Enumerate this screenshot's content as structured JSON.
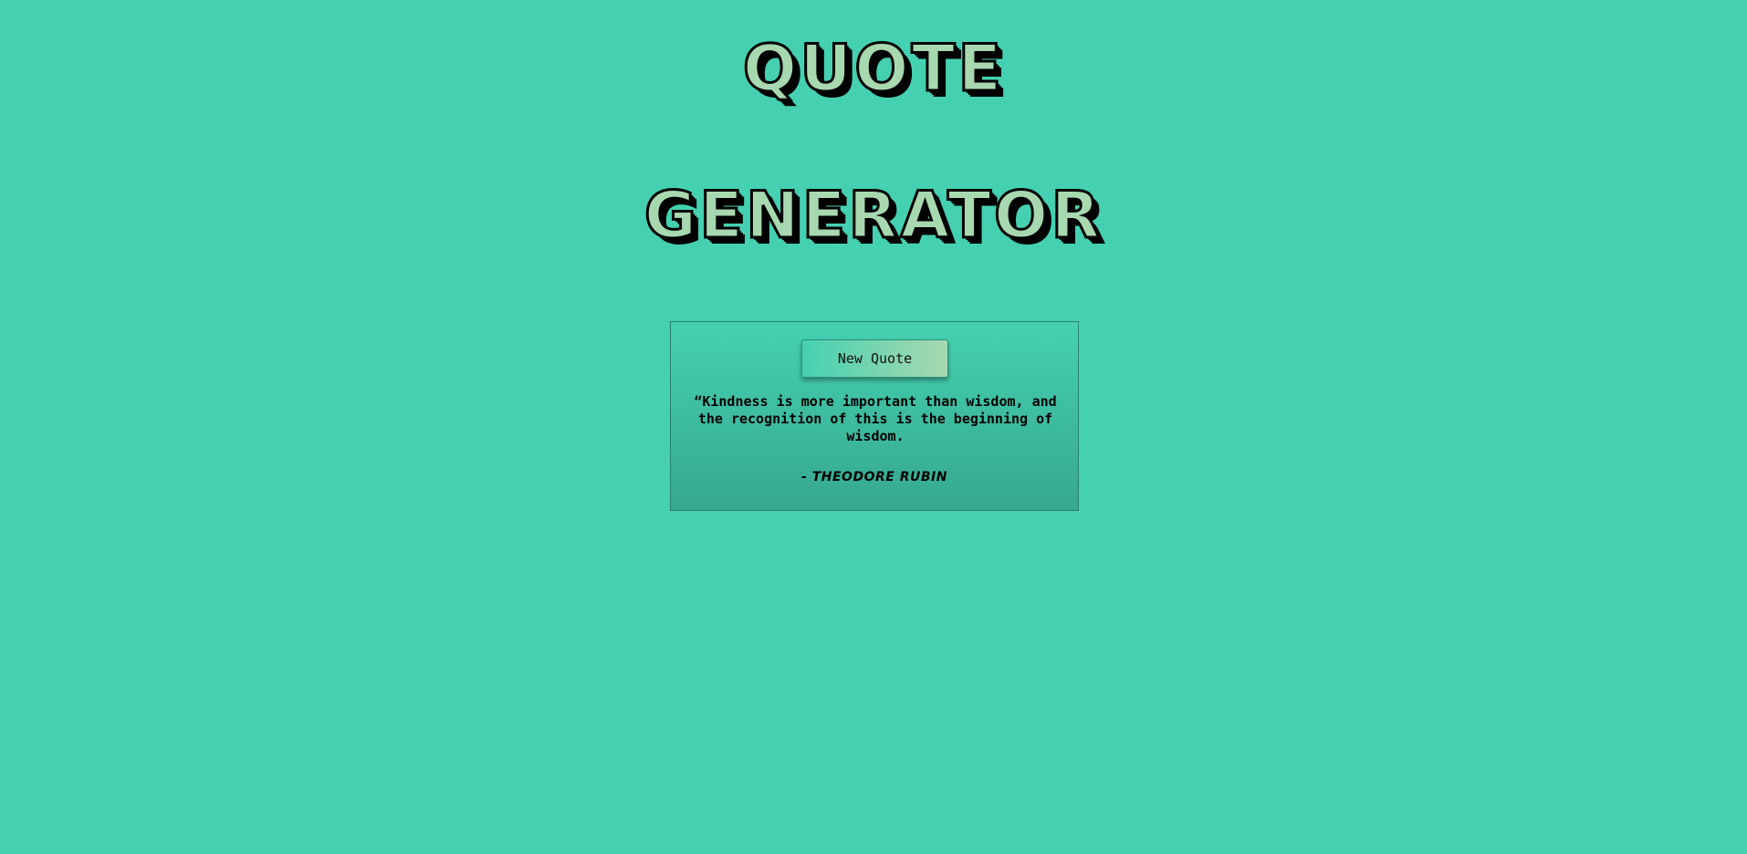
{
  "header": {
    "title_line_1": "QUOTE",
    "title_line_2": "GENERATOR"
  },
  "quote_box": {
    "button_label": "New Quote",
    "quote_text": "“Kindness is more important than wisdom, and the recognition of this is the beginning of wisdom.",
    "author": "- THEODORE RUBIN"
  },
  "colors": {
    "background": "#45d1b1",
    "title_fill": "#a8d8b0",
    "title_outline": "#000000",
    "card_gradient_top": "#45d1b1",
    "card_gradient_bottom": "#36a88f",
    "button_gradient_left": "#45d1b1",
    "button_gradient_right": "#a8d8b0"
  }
}
